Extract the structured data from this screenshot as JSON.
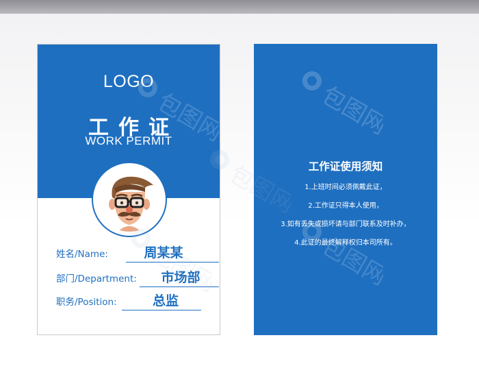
{
  "front": {
    "logo": "LOGO",
    "title_cn": "工作证",
    "title_en": "WORK PERMIT",
    "fields": [
      {
        "label": "姓名/Name:",
        "value": "周某某"
      },
      {
        "label": "部门/Department:",
        "value": "市场部"
      },
      {
        "label": "职务/Position:",
        "value": "总监"
      }
    ]
  },
  "back": {
    "title": "工作证使用须知",
    "items": [
      "1.上班时间必须佩戴此证，",
      "2.工作证只得本人使用，",
      "3.如有丢失或损坏请与部门联系及时补办，",
      "4.此证的最终解释权归本司所有。"
    ]
  },
  "watermark": "包图网",
  "colors": {
    "brand_blue": "#1f6fc0",
    "white": "#ffffff",
    "background": "#f2f2f4"
  },
  "icons": {
    "avatar": "cartoon-man-with-glasses-and-mustache",
    "watermark_logo": "ibaotu-logo"
  }
}
